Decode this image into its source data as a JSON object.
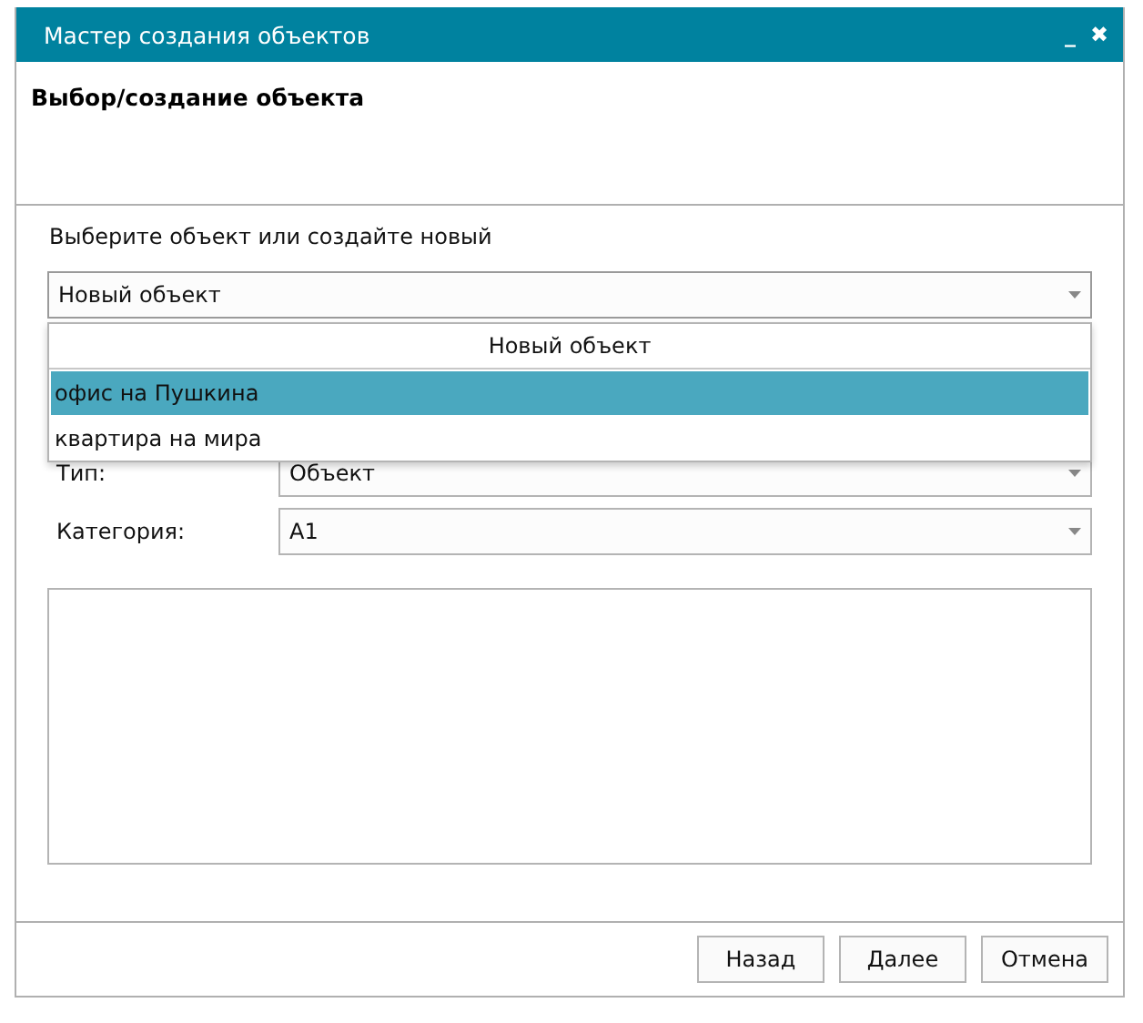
{
  "window": {
    "title": "Мастер создания объектов",
    "minimize": "_",
    "close": "✖"
  },
  "header": {
    "title": "Выбор/создание объекта"
  },
  "prompt": "Выберите объект или создайте новый",
  "object_select": {
    "value": "Новый объект",
    "expanded": true,
    "options_header": "Новый объект",
    "options": [
      {
        "label": "офис на Пушкина",
        "selected": true
      },
      {
        "label": "квартира на мира",
        "selected": false
      }
    ]
  },
  "fields": [
    {
      "label": "Тип:",
      "value": "Объект"
    },
    {
      "label": "Категория:",
      "value": "A1"
    }
  ],
  "buttons": [
    "Назад",
    "Далее",
    "Отмена"
  ]
}
